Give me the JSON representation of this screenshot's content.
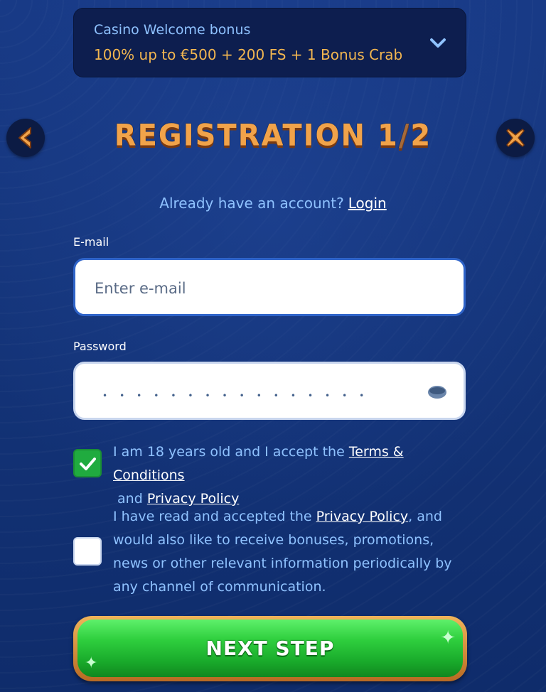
{
  "bonus": {
    "title": "Casino Welcome bonus",
    "offer": "100% up to €500 + 200 FS + 1 Bonus Crab",
    "chevron_icon": "chevron-down-icon"
  },
  "header": {
    "title_word": "REGISTRATION",
    "step_current": "1",
    "step_sep": "/",
    "step_total": "2",
    "back_icon": "chevron-left-icon",
    "close_icon": "close-icon"
  },
  "login": {
    "prompt": "Already have an account?",
    "link": "Login"
  },
  "email": {
    "label": "E-mail",
    "placeholder": "Enter e-mail",
    "value": ""
  },
  "password": {
    "label": "Password",
    "masked": "••••••••••••••••",
    "eye_icon": "eye-icon"
  },
  "consents": [
    {
      "checked": true,
      "text_before": "I am 18 years old and I accept the ",
      "link1": "Terms & Conditions",
      "text_mid": " and ",
      "link2": "Privacy Policy"
    },
    {
      "checked": false,
      "text_before": "I have read and accepted the ",
      "link1": "Privacy Policy",
      "text_after": ", and would also like to receive bonuses, promotions, news or other relevant information periodically by any channel of communication."
    }
  ],
  "next": {
    "label": "NEXT STEP"
  },
  "colors": {
    "accent_orange": "#f1a34a",
    "text_blue": "#8fc2ff",
    "bonus_gold": "#f2b650",
    "button_green": "#2fcf3e",
    "check_green": "#20ab3f"
  }
}
